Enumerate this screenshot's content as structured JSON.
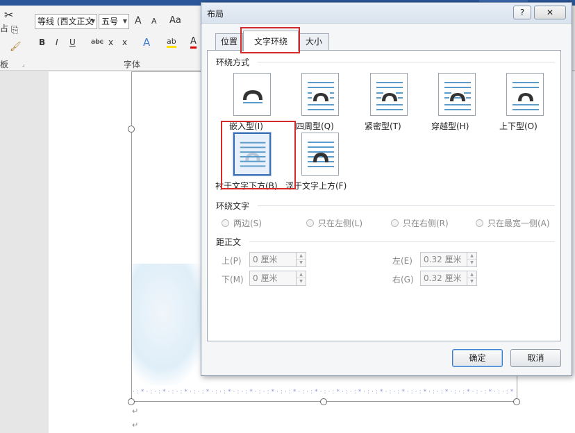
{
  "ribbon": {
    "font_name": "等线 (西文正文",
    "font_size": "五号",
    "grow_font": "A",
    "shrink_font": "A",
    "change_case": "Aa",
    "bold": "B",
    "italic": "I",
    "underline": "U",
    "strikethrough": "abc",
    "subscript": "x",
    "superscript": "x",
    "text_effects": "A",
    "highlight": "ab",
    "font_color": "A",
    "font_group_label": "字体",
    "clipboard_group_label": "板",
    "paste_fragment": "占"
  },
  "document": {
    "border_pattern": "·:*·:·:*·:·:*·:·:*·:·:*·:·:*·:·:*·:·:*·:·:*·:·:*·:·:*·:·:*·:·:*·:·:*·:·:*·:·:*·:·:*·:·:*·:",
    "return_mark": "↵"
  },
  "dialog": {
    "title": "布局",
    "help_label": "?",
    "close_label": "✕",
    "tabs": [
      {
        "label": "位置",
        "active": false
      },
      {
        "label": "文字环绕",
        "active": true
      },
      {
        "label": "大小",
        "active": false
      }
    ],
    "wrap_style_section": "环绕方式",
    "wrap_styles": [
      {
        "label": "嵌入型(I)",
        "selected": false
      },
      {
        "label": "四周型(Q)",
        "selected": false
      },
      {
        "label": "紧密型(T)",
        "selected": false
      },
      {
        "label": "穿越型(H)",
        "selected": false
      },
      {
        "label": "上下型(O)",
        "selected": false
      },
      {
        "label": "衬于文字下方(B)",
        "selected": true
      },
      {
        "label": "浮于文字上方(F)",
        "selected": false
      }
    ],
    "wrap_text_section": "环绕文字",
    "wrap_text_options": [
      "两边(S)",
      "只在左侧(L)",
      "只在右侧(R)",
      "只在最宽一侧(A)"
    ],
    "distance_section": "距正文",
    "distance": {
      "top": {
        "label": "上(P)",
        "value": "0 厘米"
      },
      "bottom": {
        "label": "下(M)",
        "value": "0 厘米"
      },
      "left": {
        "label": "左(E)",
        "value": "0.32 厘米"
      },
      "right": {
        "label": "右(G)",
        "value": "0.32 厘米"
      }
    },
    "ok_label": "确定",
    "cancel_label": "取消",
    "colors": {
      "accent": "#3a6fb4",
      "highlight_box": "#d42a2a",
      "line": "#5a9bc9",
      "arch": "#333333"
    }
  }
}
